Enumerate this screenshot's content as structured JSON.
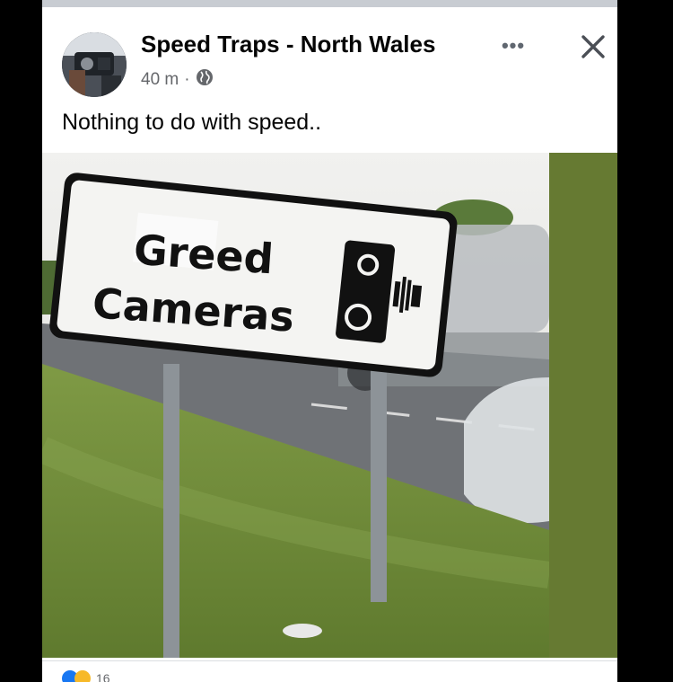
{
  "post": {
    "page_name": "Speed Traps - North Wales",
    "time": "40 m",
    "separator": "·",
    "privacy_icon": "globe-icon",
    "text": "Nothing to do with speed..",
    "more_label": "•••",
    "close_icon": "close-icon"
  },
  "image": {
    "sign_line1": "Greed",
    "sign_line2": "Cameras"
  },
  "footer": {
    "reaction_count": "16"
  },
  "colors": {
    "name": "#050505",
    "meta": "#65676b",
    "like_blue": "#1877f2",
    "haha_yellow": "#f7b928",
    "side_panel": "#667a32"
  }
}
